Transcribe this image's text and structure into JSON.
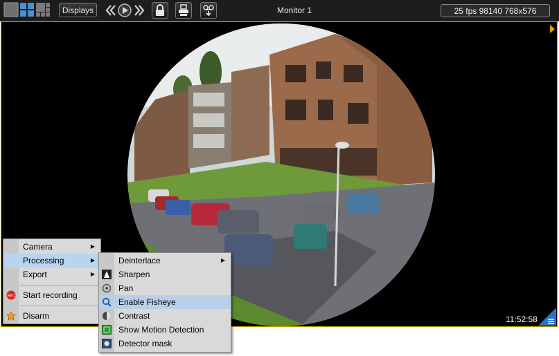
{
  "toolbar": {
    "displays_label": "Displays",
    "monitor_title": "Monitor 1",
    "status_text": "25 fps  98140 768x576"
  },
  "video": {
    "timestamp": "11:52:58"
  },
  "context_menu": {
    "items": [
      {
        "label": "Camera"
      },
      {
        "label": "Processing"
      },
      {
        "label": "Export"
      },
      {
        "label": "Start recording"
      },
      {
        "label": "Disarm"
      }
    ]
  },
  "submenu": {
    "items": [
      {
        "label": "Deinterlace"
      },
      {
        "label": "Sharpen"
      },
      {
        "label": "Pan"
      },
      {
        "label": "Enable Fisheye"
      },
      {
        "label": "Contrast"
      },
      {
        "label": "Show Motion Detection"
      },
      {
        "label": "Detector mask"
      }
    ]
  },
  "colors": {
    "highlight": "#b8d4ef",
    "video_border": "#c9a200"
  }
}
